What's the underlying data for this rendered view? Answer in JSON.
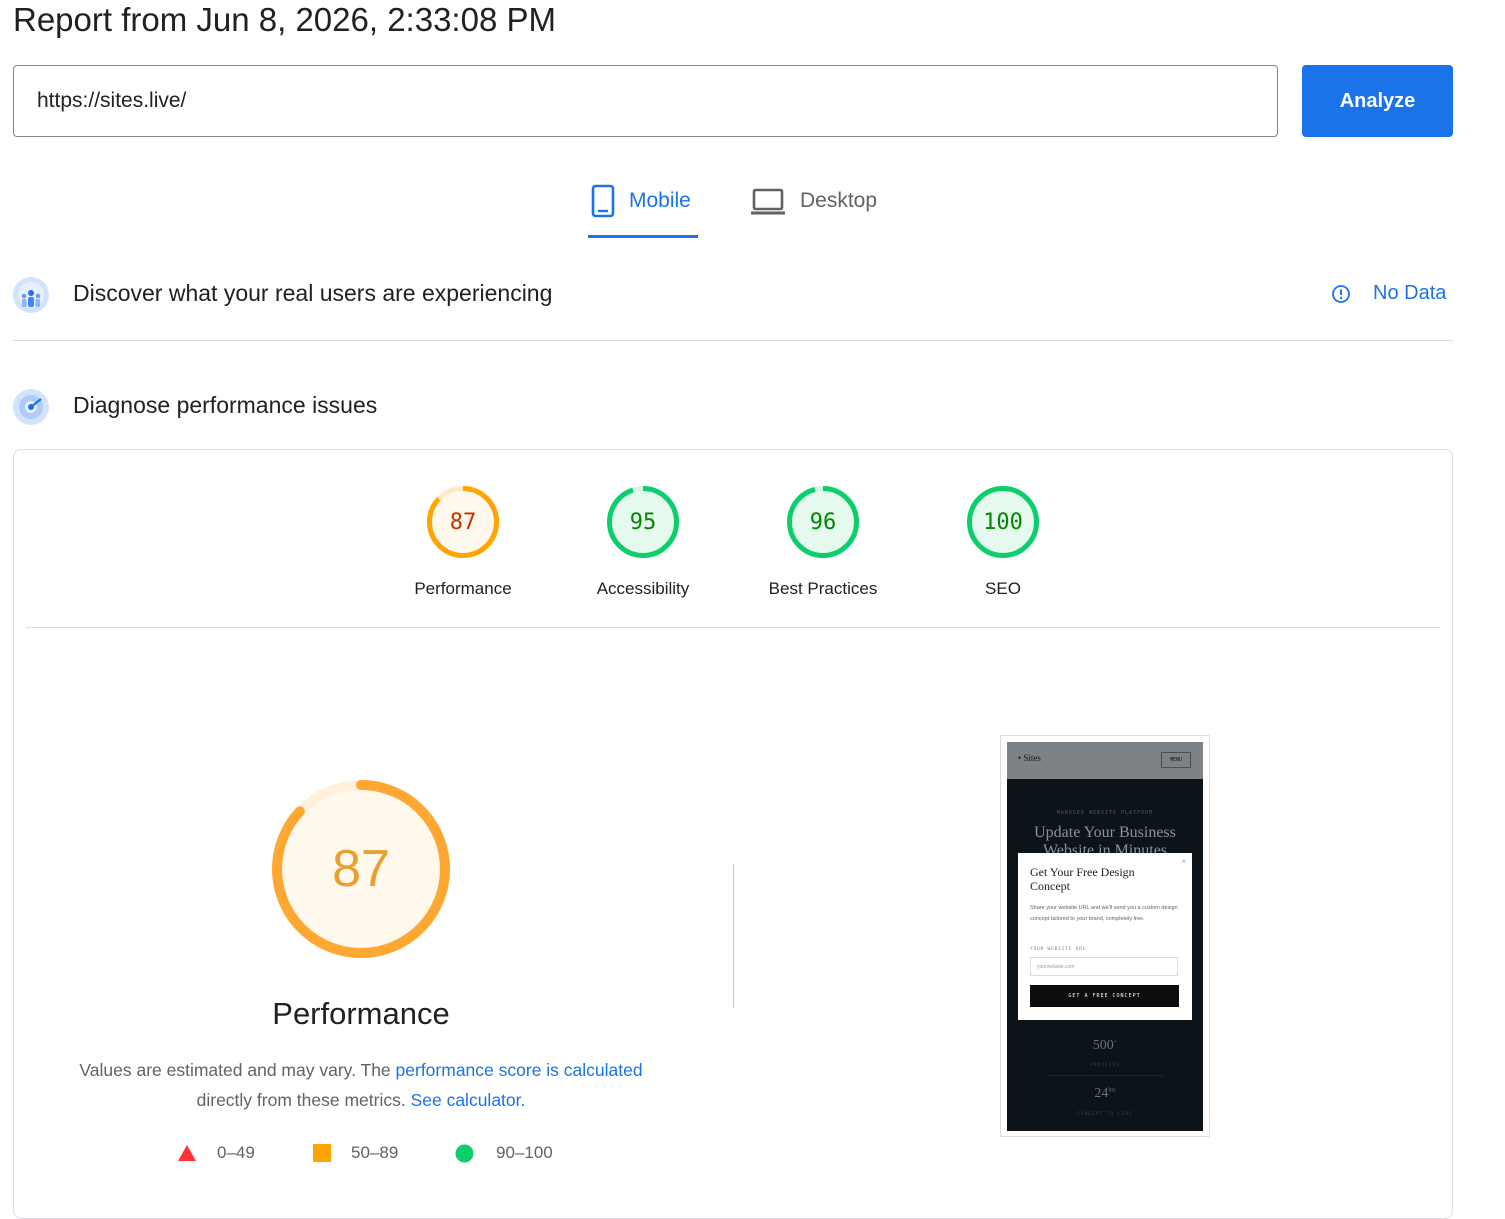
{
  "report": {
    "title": "Report from Jun 8, 2026, 2:33:08 PM"
  },
  "url_bar": {
    "value": "https://sites.live/",
    "analyze_label": "Analyze"
  },
  "tabs": [
    {
      "label": "Mobile",
      "active": true,
      "icon": "phone-icon"
    },
    {
      "label": "Desktop",
      "active": false,
      "icon": "laptop-icon"
    }
  ],
  "field_data": {
    "title": "Discover what your real users are experiencing",
    "status": "No Data",
    "icon": "info-circle-icon"
  },
  "lab_data": {
    "title": "Diagnose performance issues"
  },
  "categories": [
    {
      "label": "Performance",
      "score": 87,
      "color": "#ffa400",
      "text_color": "#c33300",
      "fill": "#fff8ed"
    },
    {
      "label": "Accessibility",
      "score": 95,
      "color": "#0cce6b",
      "text_color": "#008800",
      "fill": "#e6f9ee"
    },
    {
      "label": "Best Practices",
      "score": 96,
      "color": "#0cce6b",
      "text_color": "#008800",
      "fill": "#e6f9ee"
    },
    {
      "label": "SEO",
      "score": 100,
      "color": "#0cce6b",
      "text_color": "#008800",
      "fill": "#e6f9ee"
    }
  ],
  "performance": {
    "score": "87",
    "title": "Performance",
    "desc_prefix": "Values are estimated and may vary. The ",
    "desc_link": "performance score is calculated",
    "desc_middle": "directly from these metrics. ",
    "desc_link2": "See calculator."
  },
  "legend": [
    {
      "range": "0–49",
      "shape": "triangle",
      "color": "#ff3333"
    },
    {
      "range": "50–89",
      "shape": "square",
      "color": "#ffa400"
    },
    {
      "range": "90–100",
      "shape": "circle",
      "color": "#0cce6b"
    }
  ],
  "screenshot": {
    "brand": "• Sites",
    "menu": "MENU",
    "eyebrow": "MANAGED WEBSITE PLATFORM",
    "headline": "Update Your Business Website in Minutes",
    "modal_title": "Get Your Free Design Concept",
    "modal_body": "Share your website URL and we'll send you a custom design concept tailored to your brand, completely free.",
    "modal_label": "YOUR WEBSITE URL",
    "modal_placeholder": "yourwebsite.com",
    "modal_button": "GET A FREE CONCEPT",
    "modal_close": "×",
    "stat1_value": "500",
    "stat1_sup": "+",
    "stat1_label": "PROJECTS",
    "stat2_value": "24",
    "stat2_sup": "hrs",
    "stat2_label": "CONCEPT TO LIVE"
  }
}
